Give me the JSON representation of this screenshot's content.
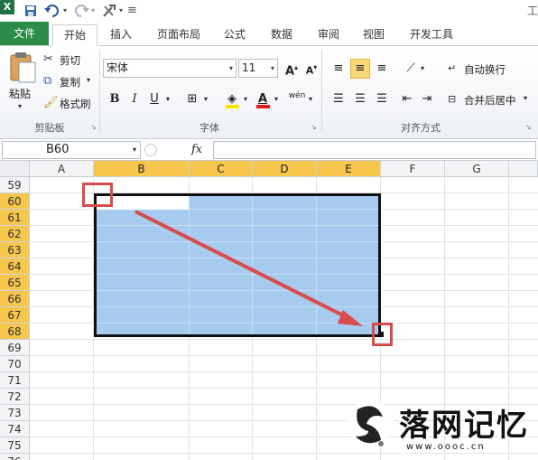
{
  "qat": {
    "app_icon": "X"
  },
  "ribbon_tabs": {
    "file": "文件",
    "home": "开始",
    "insert": "插入",
    "page_layout": "页面布局",
    "formulas": "公式",
    "data": "数据",
    "review": "审阅",
    "view": "视图",
    "developer": "开发工具"
  },
  "clipboard": {
    "paste": "粘贴",
    "cut": "剪切",
    "copy": "复制",
    "format_painter": "格式刷",
    "label": "剪贴板"
  },
  "font": {
    "name": "宋体",
    "size": "11",
    "label": "字体",
    "bold": "B",
    "italic": "I",
    "underline": "U",
    "grow": "A",
    "shrink": "A",
    "color_a": "A",
    "wen": "wén"
  },
  "alignment": {
    "wrap_text": "自动换行",
    "merge_center": "合并后居中",
    "label": "对齐方式"
  },
  "formula_bar": {
    "name_box": "B60",
    "fx": "fx"
  },
  "grid": {
    "columns": [
      "A",
      "B",
      "C",
      "D",
      "E",
      "F",
      "G"
    ],
    "rows": [
      "59",
      "60",
      "61",
      "62",
      "63",
      "64",
      "65",
      "66",
      "67",
      "68",
      "69",
      "70",
      "71",
      "72",
      "73",
      "74",
      "75",
      "76"
    ]
  },
  "watermark": {
    "text": "落网记忆",
    "url": "www.oooc.cn"
  },
  "colors": {
    "selection": "#a6cbef",
    "header_selected": "#f7c64d",
    "annotation": "#d84c4c",
    "file_tab": "#2a8c47"
  }
}
